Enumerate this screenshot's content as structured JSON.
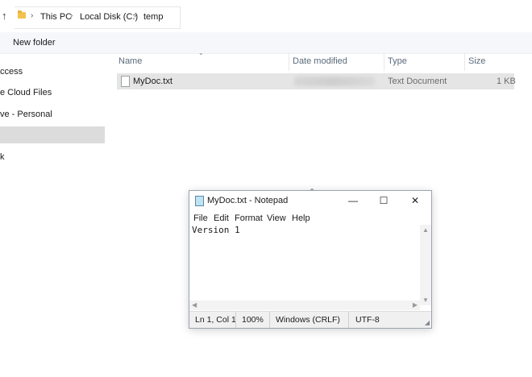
{
  "explorer": {
    "breadcrumb": [
      "This PC",
      "Local Disk (C:)",
      "temp"
    ],
    "toolbar": {
      "new_folder_label": "New folder"
    },
    "sidebar": {
      "items": [
        {
          "label": "ccess"
        },
        {
          "label": "e Cloud Files"
        },
        {
          "label": "ve - Personal"
        },
        {
          "label": ""
        },
        {
          "label": "k"
        }
      ]
    },
    "columns": [
      "Name",
      "Date modified",
      "Type",
      "Size"
    ],
    "files": [
      {
        "name": "MyDoc.txt",
        "type": "Text Document",
        "size": "1 KB"
      }
    ]
  },
  "notepad": {
    "title": "MyDoc.txt - Notepad",
    "window_controls": {
      "minimize": "—",
      "maximize": "☐",
      "close": "✕"
    },
    "menu": [
      "File",
      "Edit",
      "Format",
      "View",
      "Help"
    ],
    "content": "Version 1",
    "status": {
      "position": "Ln 1, Col 1",
      "zoom": "100%",
      "line_ending": "Windows (CRLF)",
      "encoding": "UTF-8"
    }
  }
}
